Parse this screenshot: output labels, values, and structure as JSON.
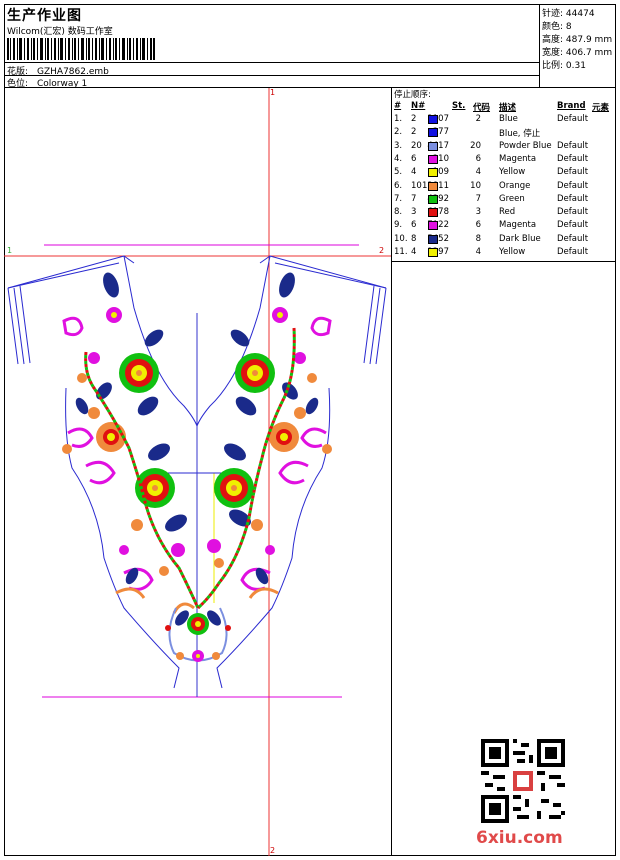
{
  "header": {
    "title": "生产作业图",
    "company": "Wilcom(汇宏) 数码工作室",
    "design_label": "花版:",
    "design_value": "GZHA7862.emb",
    "colorway_label": "色位:",
    "colorway_value": "Colorway 1"
  },
  "stats": {
    "stitches_label": "针迹:",
    "stitches_value": "44474",
    "colors_label": "颜色:",
    "colors_value": "8",
    "height_label": "高度:",
    "height_value": "487.9 mm",
    "width_label": "宽度:",
    "width_value": "406.7 mm",
    "scale_label": "比例:",
    "scale_value": "0.31"
  },
  "stop_sequence": {
    "title": "停止顺序:",
    "headers": {
      "index": "#",
      "needle": "N#",
      "st": "St.",
      "code": "代码",
      "desc": "描述",
      "brand": "Brand",
      "element": "元素"
    },
    "rows": [
      {
        "index": "1.",
        "needle": "2",
        "color": "#1010e0",
        "st": "2107",
        "code": "2",
        "desc": "Blue",
        "brand": "Default"
      },
      {
        "index": "2.",
        "needle": "2",
        "color": "#1010e0",
        "st": "377",
        "code": "",
        "desc": "Blue, 停止",
        "brand": ""
      },
      {
        "index": "3.",
        "needle": "20",
        "color": "#7b8fe0",
        "st": "4417",
        "code": "20",
        "desc": "Powder Blue",
        "brand": "Default"
      },
      {
        "index": "4.",
        "needle": "6",
        "color": "#e010e0",
        "st": "210",
        "code": "6",
        "desc": "Magenta",
        "brand": "Default"
      },
      {
        "index": "5.",
        "needle": "4",
        "color": "#f0f000",
        "st": "109",
        "code": "4",
        "desc": "Yellow",
        "brand": "Default"
      },
      {
        "index": "6.",
        "needle": "10",
        "color": "#f08a3c",
        "st": "12811",
        "code": "10",
        "desc": "Orange",
        "brand": "Default"
      },
      {
        "index": "7.",
        "needle": "7",
        "color": "#10c010",
        "st": "4392",
        "code": "7",
        "desc": "Green",
        "brand": "Default"
      },
      {
        "index": "8.",
        "needle": "3",
        "color": "#e01010",
        "st": "6178",
        "code": "3",
        "desc": "Red",
        "brand": "Default"
      },
      {
        "index": "9.",
        "needle": "6",
        "color": "#e010e0",
        "st": "7122",
        "code": "6",
        "desc": "Magenta",
        "brand": "Default"
      },
      {
        "index": "10.",
        "needle": "8",
        "color": "#1a2a8a",
        "st": "5452",
        "code": "8",
        "desc": "Dark Blue",
        "brand": "Default"
      },
      {
        "index": "11.",
        "needle": "4",
        "color": "#f0f000",
        "st": "1297",
        "code": "4",
        "desc": "Yellow",
        "brand": "Default"
      }
    ]
  },
  "canvas": {
    "marker_top": "1",
    "marker_bottom": "2",
    "marker_left": "1",
    "marker_right": "2"
  },
  "watermark": {
    "text": "6xiu.com"
  }
}
